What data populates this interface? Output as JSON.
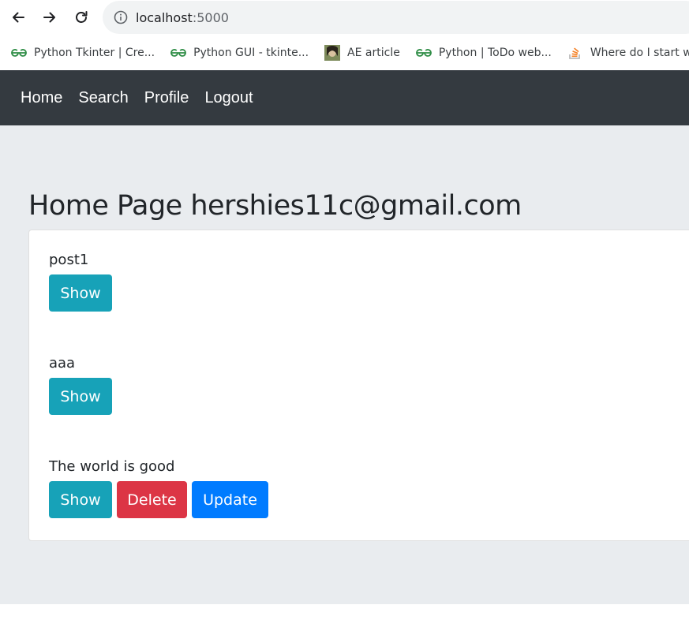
{
  "browser": {
    "url_host": "localhost",
    "url_port": ":5000",
    "bookmarks": [
      {
        "label": "Python Tkinter | Cre...",
        "icon": "geeksforgeeks-icon"
      },
      {
        "label": "Python GUI - tkinte...",
        "icon": "geeksforgeeks-icon"
      },
      {
        "label": "AE article",
        "icon": "avatar-icon"
      },
      {
        "label": "Python | ToDo web...",
        "icon": "geeksforgeeks-icon"
      },
      {
        "label": "Where do I start wit...",
        "icon": "stackoverflow-icon"
      }
    ]
  },
  "navbar": {
    "items": [
      "Home",
      "Search",
      "Profile",
      "Logout"
    ]
  },
  "page": {
    "title": "Home Page hershies11c@gmail.com"
  },
  "posts": [
    {
      "title": "post1",
      "show_label": "Show"
    },
    {
      "title": "aaa",
      "show_label": "Show"
    },
    {
      "title": "The world is good",
      "show_label": "Show",
      "delete_label": "Delete",
      "update_label": "Update"
    }
  ],
  "colors": {
    "navbar_bg": "#343a40",
    "page_bg": "#e9ecef",
    "info": "#17a2b8",
    "danger": "#dc3545",
    "primary": "#007bff"
  }
}
